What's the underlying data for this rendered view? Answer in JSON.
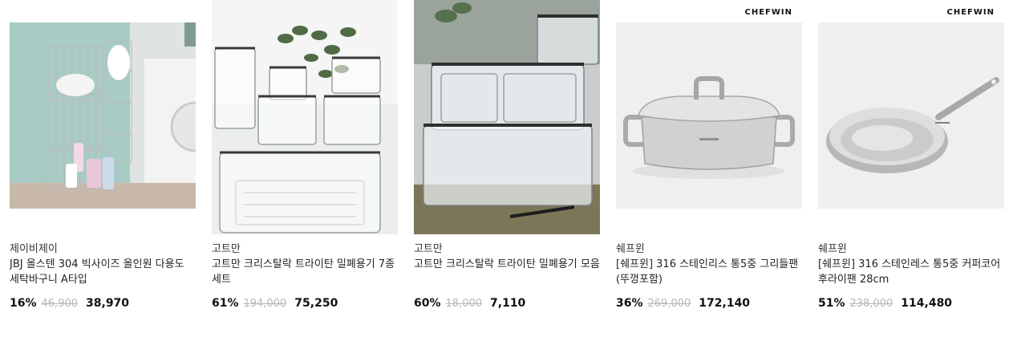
{
  "products": [
    {
      "brand": "제이비제이",
      "title": "JBJ 올스텐 304 빅사이즈 올인원 다용도 세탁바구니 A타입",
      "discount": "16%",
      "original_price": "46,900",
      "price": "38,970",
      "image_icon": "laundry-basket-icon"
    },
    {
      "brand": "고트만",
      "title": "고트만 크리스탈락 트라이탄 밀폐용기 7종세트",
      "discount": "61%",
      "original_price": "194,000",
      "price": "75,250",
      "image_icon": "food-container-icon"
    },
    {
      "brand": "고트만",
      "title": "고트만 크리스탈락 트라이탄 밀폐용기 모음",
      "discount": "60%",
      "original_price": "18,000",
      "price": "7,110",
      "image_icon": "food-container-icon"
    },
    {
      "brand": "쉐프윈",
      "title": "[쉐프윈] 316 스테인리스 통5중 그리들팬(뚜껑포함)",
      "discount": "36%",
      "original_price": "269,000",
      "price": "172,140",
      "image_logo": "CHEFWIN",
      "image_icon": "griddle-pan-icon"
    },
    {
      "brand": "쉐프윈",
      "title": "[쉐프윈] 316 스테인레스 통5중 커퍼코어 후라이팬 28cm",
      "discount": "51%",
      "original_price": "238,000",
      "price": "114,480",
      "image_logo": "CHEFWIN",
      "image_icon": "frying-pan-icon"
    }
  ]
}
